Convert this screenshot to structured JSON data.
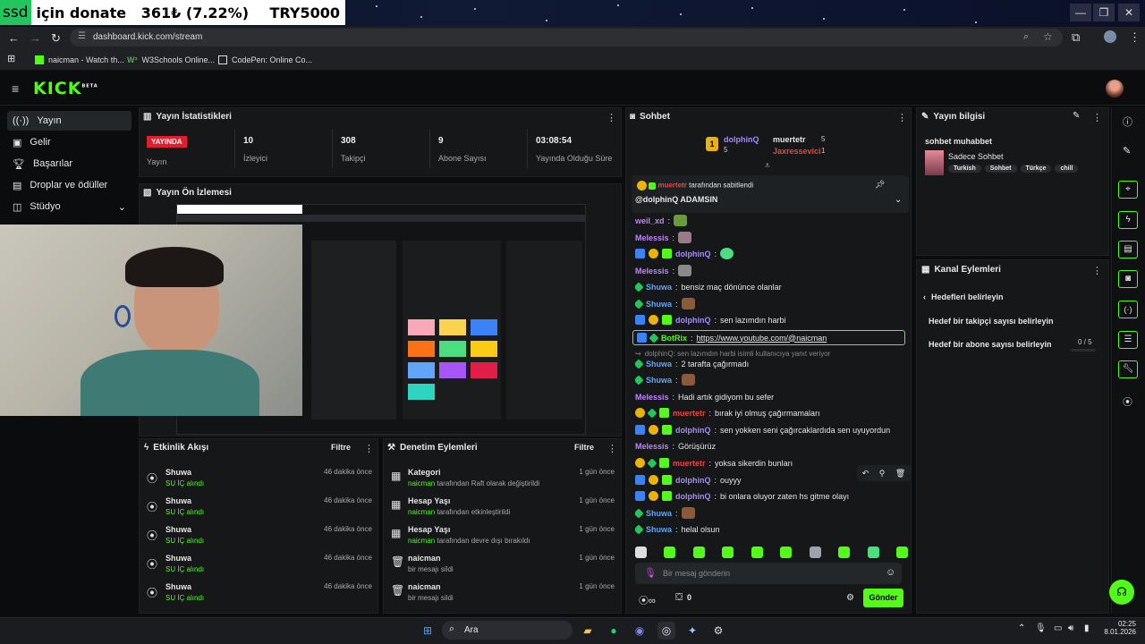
{
  "window": {
    "donate_badge": "ssd",
    "donate_text": "için donate   361₺ (7.22%)",
    "donate_goal": "TRY5000",
    "min": "—",
    "restore": "❐",
    "close": "✕"
  },
  "browser": {
    "url": "dashboard.kick.com/stream",
    "bookmarks": [
      "naicman - Watch th...",
      "W3Schools Online...",
      "CodePen: Online Co..."
    ]
  },
  "kick": {
    "logo": "KICK",
    "logo_sup": "BETA"
  },
  "sidebar": {
    "items": [
      {
        "label": "Yayın",
        "icon": "broadcast-icon"
      },
      {
        "label": "Gelir",
        "icon": "wallet-icon"
      },
      {
        "label": "Başarılar",
        "icon": "trophy-icon"
      },
      {
        "label": "Droplar ve ödüller",
        "icon": "gift-icon"
      },
      {
        "label": "Stüdyo",
        "icon": "studio-icon"
      }
    ]
  },
  "stats": {
    "title": "Yayın İstatistikleri",
    "live_badge": "YAYINDA",
    "live_label": "Yayın",
    "items": [
      {
        "value": "10",
        "label": "İzleyici"
      },
      {
        "value": "308",
        "label": "Takipçi"
      },
      {
        "value": "9",
        "label": "Abone Sayısı"
      },
      {
        "value": "03:08:54",
        "label": "Yayında Olduğu Süre"
      }
    ]
  },
  "preview": {
    "title": "Yayın Ön İzlemesi"
  },
  "activity": {
    "title": "Etkinlik Akışı",
    "filter": "Filtre",
    "items": [
      {
        "user": "Shuwa",
        "action": "SU İÇ alındı",
        "time": "46 dakika önce"
      },
      {
        "user": "Shuwa",
        "action": "SU İÇ alındı",
        "time": "46 dakika önce"
      },
      {
        "user": "Shuwa",
        "action": "SU İÇ alındı",
        "time": "46 dakika önce"
      },
      {
        "user": "Shuwa",
        "action": "SU İÇ alındı",
        "time": "46 dakika önce"
      },
      {
        "user": "Shuwa",
        "action": "SU İÇ alındı",
        "time": "46 dakika önce"
      }
    ]
  },
  "moderation": {
    "title": "Denetim Eylemleri",
    "filter": "Filtre",
    "items": [
      {
        "title": "Kategori",
        "detail_user": "naicman",
        "detail": "tarafından Raft olarak değiştirildi",
        "time": "1 gün önce"
      },
      {
        "title": "Hesap Yaşı",
        "detail_user": "naicman",
        "detail": "tarafından etkinleştirildi",
        "time": "1 gün önce"
      },
      {
        "title": "Hesap Yaşı",
        "detail_user": "naicman",
        "detail": "tarafından devre dışı bırakıldı",
        "time": "1 gün önce"
      },
      {
        "title": "naicman",
        "detail_user": "",
        "detail": "bir mesajı sildi",
        "time": "1 gün önce"
      },
      {
        "title": "naicman",
        "detail_user": "",
        "detail": "bir mesajı sildi",
        "time": "1 gün önce"
      }
    ]
  },
  "chat": {
    "title": "Sohbet",
    "top": [
      {
        "name": "dolphinQ",
        "count": "5"
      },
      {
        "name": "muertetr",
        "count": "5"
      },
      {
        "name": "Jaxressevici",
        "count": "1"
      }
    ],
    "pinned_by": "tarafından sabitlendi",
    "pinned_user": "muertetr",
    "pinned_text": "@dolphinQ ADAMSIN",
    "messages": [
      {
        "user": "weil_xd",
        "text": "",
        "color": "#c084fc"
      },
      {
        "user": "Melessis",
        "text": "",
        "color": "#c084fc"
      },
      {
        "user": "dolphinQ",
        "text": "",
        "color": "#a78bfa"
      },
      {
        "user": "Melessis",
        "text": "",
        "color": "#c084fc"
      },
      {
        "user": "Shuwa",
        "text": "bensiz maç dönünce olanlar",
        "color": "#60a5fa"
      },
      {
        "user": "Shuwa",
        "text": "",
        "color": "#60a5fa"
      },
      {
        "user": "dolphinQ",
        "text": "sen lazımdın harbi",
        "color": "#a78bfa"
      },
      {
        "user": "BotRix",
        "text": "https://www.youtube.com/@naicman",
        "color": "#53fc18"
      },
      {
        "user": "",
        "text": "dolphinQ: sen lazımdın harbi isimli kullanıcıya yanıt veriyor",
        "color": "#888"
      },
      {
        "user": "Shuwa",
        "text": "2 tarafta çağırmadı",
        "color": "#60a5fa"
      },
      {
        "user": "Shuwa",
        "text": "",
        "color": "#60a5fa"
      },
      {
        "user": "Melessis",
        "text": "Hadi artık gidiyom bu sefer",
        "color": "#c084fc"
      },
      {
        "user": "muertetr",
        "text": "bırak iyi olmuş çağırmamaları",
        "color": "#ef4444"
      },
      {
        "user": "dolphinQ",
        "text": "sen yokken seni çağırcaklardıda sen uyuyordun",
        "color": "#a78bfa"
      },
      {
        "user": "Melessis",
        "text": "Görüşürüz",
        "color": "#c084fc"
      },
      {
        "user": "muertetr",
        "text": "yoksa sikerdin bunları",
        "color": "#ef4444"
      },
      {
        "user": "dolphinQ",
        "text": "ouyyy",
        "color": "#a78bfa"
      },
      {
        "user": "dolphinQ",
        "text": "bi onlara oluyor zaten hs gitme olayı",
        "color": "#a78bfa"
      },
      {
        "user": "Shuwa",
        "text": "",
        "color": "#60a5fa"
      },
      {
        "user": "Shuwa",
        "text": "helal olsun",
        "color": "#60a5fa"
      }
    ],
    "input_placeholder": "Bir mesaj gönderin",
    "points": "0",
    "send": "Gönder"
  },
  "stream_info": {
    "title": "Yayın bilgisi",
    "stream_title": "sohbet muhabbet",
    "category": "Sadece Sohbet",
    "tags": [
      "Turkish",
      "Sohbet",
      "Türkçe",
      "chill"
    ]
  },
  "channel_actions": {
    "title": "Kanal Eylemleri",
    "back": "Hedefleri belirleyin",
    "items": [
      {
        "label": "Hedef bir takipçi sayısı belirleyin",
        "value": ""
      },
      {
        "label": "Hedef bir abone sayısı belirleyin",
        "value": "0 / 5",
        "progress": 0
      }
    ]
  },
  "taskbar": {
    "search": "Ara",
    "time": "02:25",
    "date": "8.01.2026"
  },
  "colors": {
    "accent": "#53fc18",
    "live": "#e11d2e",
    "bg": "#0b0c0d",
    "panel": "#151718"
  }
}
